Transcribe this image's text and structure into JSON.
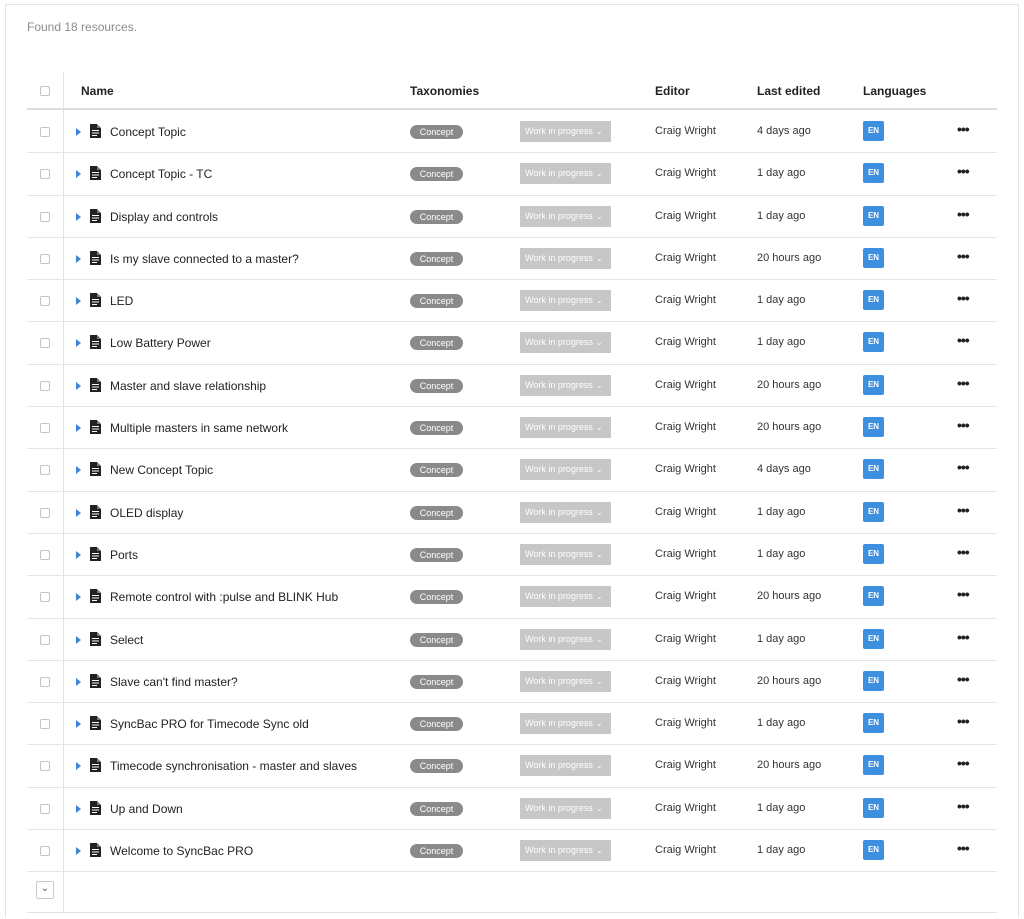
{
  "summary": "Found 18 resources.",
  "columns": {
    "name": "Name",
    "taxonomies": "Taxonomies",
    "editor": "Editor",
    "last_edited": "Last edited",
    "languages": "Languages"
  },
  "colors": {
    "accent": "#3d8fe0",
    "taxonomy_badge": "#8a8a8a",
    "status_button": "#c7c7c7"
  },
  "rows": [
    {
      "name": "Concept Topic",
      "taxonomy": "Concept",
      "status": "Work in progress",
      "editor": "Craig Wright",
      "last_edited": "4 days ago",
      "language": "EN"
    },
    {
      "name": "Concept Topic - TC",
      "taxonomy": "Concept",
      "status": "Work in progress",
      "editor": "Craig Wright",
      "last_edited": "1 day ago",
      "language": "EN"
    },
    {
      "name": "Display and controls",
      "taxonomy": "Concept",
      "status": "Work in progress",
      "editor": "Craig Wright",
      "last_edited": "1 day ago",
      "language": "EN"
    },
    {
      "name": "Is my slave connected to a master?",
      "taxonomy": "Concept",
      "status": "Work in progress",
      "editor": "Craig Wright",
      "last_edited": "20 hours ago",
      "language": "EN"
    },
    {
      "name": "LED",
      "taxonomy": "Concept",
      "status": "Work in progress",
      "editor": "Craig Wright",
      "last_edited": "1 day ago",
      "language": "EN"
    },
    {
      "name": "Low Battery Power",
      "taxonomy": "Concept",
      "status": "Work in progress",
      "editor": "Craig Wright",
      "last_edited": "1 day ago",
      "language": "EN"
    },
    {
      "name": "Master and slave relationship",
      "taxonomy": "Concept",
      "status": "Work in progress",
      "editor": "Craig Wright",
      "last_edited": "20 hours ago",
      "language": "EN"
    },
    {
      "name": "Multiple masters in same network",
      "taxonomy": "Concept",
      "status": "Work in progress",
      "editor": "Craig Wright",
      "last_edited": "20 hours ago",
      "language": "EN"
    },
    {
      "name": "New Concept Topic",
      "taxonomy": "Concept",
      "status": "Work in progress",
      "editor": "Craig Wright",
      "last_edited": "4 days ago",
      "language": "EN"
    },
    {
      "name": "OLED display",
      "taxonomy": "Concept",
      "status": "Work in progress",
      "editor": "Craig Wright",
      "last_edited": "1 day ago",
      "language": "EN"
    },
    {
      "name": "Ports",
      "taxonomy": "Concept",
      "status": "Work in progress",
      "editor": "Craig Wright",
      "last_edited": "1 day ago",
      "language": "EN"
    },
    {
      "name": "Remote control with :pulse and BLINK Hub",
      "taxonomy": "Concept",
      "status": "Work in progress",
      "editor": "Craig Wright",
      "last_edited": "20 hours ago",
      "language": "EN"
    },
    {
      "name": "Select",
      "taxonomy": "Concept",
      "status": "Work in progress",
      "editor": "Craig Wright",
      "last_edited": "1 day ago",
      "language": "EN"
    },
    {
      "name": "Slave can't find master?",
      "taxonomy": "Concept",
      "status": "Work in progress",
      "editor": "Craig Wright",
      "last_edited": "20 hours ago",
      "language": "EN"
    },
    {
      "name": "SyncBac PRO for Timecode Sync old",
      "taxonomy": "Concept",
      "status": "Work in progress",
      "editor": "Craig Wright",
      "last_edited": "1 day ago",
      "language": "EN"
    },
    {
      "name": "Timecode synchronisation - master and slaves",
      "taxonomy": "Concept",
      "status": "Work in progress",
      "editor": "Craig Wright",
      "last_edited": "20 hours ago",
      "language": "EN"
    },
    {
      "name": "Up and Down",
      "taxonomy": "Concept",
      "status": "Work in progress",
      "editor": "Craig Wright",
      "last_edited": "1 day ago",
      "language": "EN"
    },
    {
      "name": "Welcome to SyncBac PRO",
      "taxonomy": "Concept",
      "status": "Work in progress",
      "editor": "Craig Wright",
      "last_edited": "1 day ago",
      "language": "EN"
    }
  ]
}
